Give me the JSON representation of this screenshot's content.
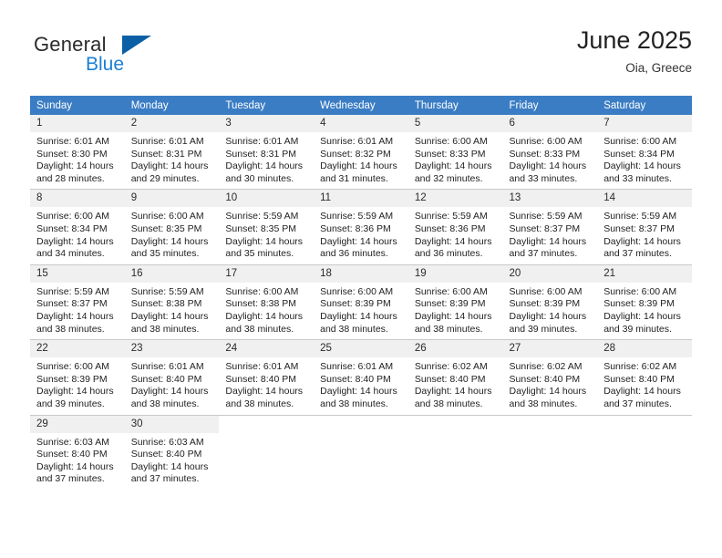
{
  "brand": {
    "name_part1": "General",
    "name_part2": "Blue",
    "mark_icon": "blue-triangle-logo-icon",
    "accent_color": "#1b7fd4",
    "mark_color": "#0b5fa5"
  },
  "header": {
    "title": "June 2025",
    "subtitle": "Oia, Greece"
  },
  "calendar": {
    "header_bg_color": "#3b7dc4",
    "daynum_bg_color": "#f0f0f0",
    "weekdays": [
      "Sunday",
      "Monday",
      "Tuesday",
      "Wednesday",
      "Thursday",
      "Friday",
      "Saturday"
    ],
    "weeks": [
      [
        {
          "day": "1",
          "sunrise": "Sunrise: 6:01 AM",
          "sunset": "Sunset: 8:30 PM",
          "daylight_line1": "Daylight: 14 hours",
          "daylight_line2": "and 28 minutes."
        },
        {
          "day": "2",
          "sunrise": "Sunrise: 6:01 AM",
          "sunset": "Sunset: 8:31 PM",
          "daylight_line1": "Daylight: 14 hours",
          "daylight_line2": "and 29 minutes."
        },
        {
          "day": "3",
          "sunrise": "Sunrise: 6:01 AM",
          "sunset": "Sunset: 8:31 PM",
          "daylight_line1": "Daylight: 14 hours",
          "daylight_line2": "and 30 minutes."
        },
        {
          "day": "4",
          "sunrise": "Sunrise: 6:01 AM",
          "sunset": "Sunset: 8:32 PM",
          "daylight_line1": "Daylight: 14 hours",
          "daylight_line2": "and 31 minutes."
        },
        {
          "day": "5",
          "sunrise": "Sunrise: 6:00 AM",
          "sunset": "Sunset: 8:33 PM",
          "daylight_line1": "Daylight: 14 hours",
          "daylight_line2": "and 32 minutes."
        },
        {
          "day": "6",
          "sunrise": "Sunrise: 6:00 AM",
          "sunset": "Sunset: 8:33 PM",
          "daylight_line1": "Daylight: 14 hours",
          "daylight_line2": "and 33 minutes."
        },
        {
          "day": "7",
          "sunrise": "Sunrise: 6:00 AM",
          "sunset": "Sunset: 8:34 PM",
          "daylight_line1": "Daylight: 14 hours",
          "daylight_line2": "and 33 minutes."
        }
      ],
      [
        {
          "day": "8",
          "sunrise": "Sunrise: 6:00 AM",
          "sunset": "Sunset: 8:34 PM",
          "daylight_line1": "Daylight: 14 hours",
          "daylight_line2": "and 34 minutes."
        },
        {
          "day": "9",
          "sunrise": "Sunrise: 6:00 AM",
          "sunset": "Sunset: 8:35 PM",
          "daylight_line1": "Daylight: 14 hours",
          "daylight_line2": "and 35 minutes."
        },
        {
          "day": "10",
          "sunrise": "Sunrise: 5:59 AM",
          "sunset": "Sunset: 8:35 PM",
          "daylight_line1": "Daylight: 14 hours",
          "daylight_line2": "and 35 minutes."
        },
        {
          "day": "11",
          "sunrise": "Sunrise: 5:59 AM",
          "sunset": "Sunset: 8:36 PM",
          "daylight_line1": "Daylight: 14 hours",
          "daylight_line2": "and 36 minutes."
        },
        {
          "day": "12",
          "sunrise": "Sunrise: 5:59 AM",
          "sunset": "Sunset: 8:36 PM",
          "daylight_line1": "Daylight: 14 hours",
          "daylight_line2": "and 36 minutes."
        },
        {
          "day": "13",
          "sunrise": "Sunrise: 5:59 AM",
          "sunset": "Sunset: 8:37 PM",
          "daylight_line1": "Daylight: 14 hours",
          "daylight_line2": "and 37 minutes."
        },
        {
          "day": "14",
          "sunrise": "Sunrise: 5:59 AM",
          "sunset": "Sunset: 8:37 PM",
          "daylight_line1": "Daylight: 14 hours",
          "daylight_line2": "and 37 minutes."
        }
      ],
      [
        {
          "day": "15",
          "sunrise": "Sunrise: 5:59 AM",
          "sunset": "Sunset: 8:37 PM",
          "daylight_line1": "Daylight: 14 hours",
          "daylight_line2": "and 38 minutes."
        },
        {
          "day": "16",
          "sunrise": "Sunrise: 5:59 AM",
          "sunset": "Sunset: 8:38 PM",
          "daylight_line1": "Daylight: 14 hours",
          "daylight_line2": "and 38 minutes."
        },
        {
          "day": "17",
          "sunrise": "Sunrise: 6:00 AM",
          "sunset": "Sunset: 8:38 PM",
          "daylight_line1": "Daylight: 14 hours",
          "daylight_line2": "and 38 minutes."
        },
        {
          "day": "18",
          "sunrise": "Sunrise: 6:00 AM",
          "sunset": "Sunset: 8:39 PM",
          "daylight_line1": "Daylight: 14 hours",
          "daylight_line2": "and 38 minutes."
        },
        {
          "day": "19",
          "sunrise": "Sunrise: 6:00 AM",
          "sunset": "Sunset: 8:39 PM",
          "daylight_line1": "Daylight: 14 hours",
          "daylight_line2": "and 38 minutes."
        },
        {
          "day": "20",
          "sunrise": "Sunrise: 6:00 AM",
          "sunset": "Sunset: 8:39 PM",
          "daylight_line1": "Daylight: 14 hours",
          "daylight_line2": "and 39 minutes."
        },
        {
          "day": "21",
          "sunrise": "Sunrise: 6:00 AM",
          "sunset": "Sunset: 8:39 PM",
          "daylight_line1": "Daylight: 14 hours",
          "daylight_line2": "and 39 minutes."
        }
      ],
      [
        {
          "day": "22",
          "sunrise": "Sunrise: 6:00 AM",
          "sunset": "Sunset: 8:39 PM",
          "daylight_line1": "Daylight: 14 hours",
          "daylight_line2": "and 39 minutes."
        },
        {
          "day": "23",
          "sunrise": "Sunrise: 6:01 AM",
          "sunset": "Sunset: 8:40 PM",
          "daylight_line1": "Daylight: 14 hours",
          "daylight_line2": "and 38 minutes."
        },
        {
          "day": "24",
          "sunrise": "Sunrise: 6:01 AM",
          "sunset": "Sunset: 8:40 PM",
          "daylight_line1": "Daylight: 14 hours",
          "daylight_line2": "and 38 minutes."
        },
        {
          "day": "25",
          "sunrise": "Sunrise: 6:01 AM",
          "sunset": "Sunset: 8:40 PM",
          "daylight_line1": "Daylight: 14 hours",
          "daylight_line2": "and 38 minutes."
        },
        {
          "day": "26",
          "sunrise": "Sunrise: 6:02 AM",
          "sunset": "Sunset: 8:40 PM",
          "daylight_line1": "Daylight: 14 hours",
          "daylight_line2": "and 38 minutes."
        },
        {
          "day": "27",
          "sunrise": "Sunrise: 6:02 AM",
          "sunset": "Sunset: 8:40 PM",
          "daylight_line1": "Daylight: 14 hours",
          "daylight_line2": "and 38 minutes."
        },
        {
          "day": "28",
          "sunrise": "Sunrise: 6:02 AM",
          "sunset": "Sunset: 8:40 PM",
          "daylight_line1": "Daylight: 14 hours",
          "daylight_line2": "and 37 minutes."
        }
      ],
      [
        {
          "day": "29",
          "sunrise": "Sunrise: 6:03 AM",
          "sunset": "Sunset: 8:40 PM",
          "daylight_line1": "Daylight: 14 hours",
          "daylight_line2": "and 37 minutes."
        },
        {
          "day": "30",
          "sunrise": "Sunrise: 6:03 AM",
          "sunset": "Sunset: 8:40 PM",
          "daylight_line1": "Daylight: 14 hours",
          "daylight_line2": "and 37 minutes."
        },
        {
          "day": "",
          "sunrise": "",
          "sunset": "",
          "daylight_line1": "",
          "daylight_line2": ""
        },
        {
          "day": "",
          "sunrise": "",
          "sunset": "",
          "daylight_line1": "",
          "daylight_line2": ""
        },
        {
          "day": "",
          "sunrise": "",
          "sunset": "",
          "daylight_line1": "",
          "daylight_line2": ""
        },
        {
          "day": "",
          "sunrise": "",
          "sunset": "",
          "daylight_line1": "",
          "daylight_line2": ""
        },
        {
          "day": "",
          "sunrise": "",
          "sunset": "",
          "daylight_line1": "",
          "daylight_line2": ""
        }
      ]
    ]
  }
}
